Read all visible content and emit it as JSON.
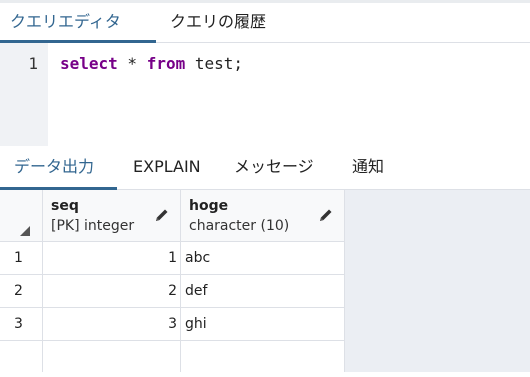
{
  "editor_tabs": [
    {
      "label": "クエリエディタ",
      "active": true
    },
    {
      "label": "クエリの履歴",
      "active": false
    }
  ],
  "editor": {
    "line_number": "1",
    "tokens": [
      "select",
      " * ",
      "from",
      " test;"
    ]
  },
  "output_tabs": [
    {
      "label": "データ出力",
      "active": true
    },
    {
      "label": "EXPLAIN",
      "active": false
    },
    {
      "label": "メッセージ",
      "active": false
    },
    {
      "label": "通知",
      "active": false
    }
  ],
  "grid": {
    "columns": [
      {
        "name": "seq",
        "type": "[PK] integer"
      },
      {
        "name": "hoge",
        "type": "character (10)"
      }
    ],
    "rows": [
      {
        "row_number": "1",
        "seq": "1",
        "hoge": "abc"
      },
      {
        "row_number": "2",
        "seq": "2",
        "hoge": "def"
      },
      {
        "row_number": "3",
        "seq": "3",
        "hoge": "ghi"
      }
    ]
  },
  "colors": {
    "accent": "#326690",
    "keyword": "#770088",
    "gutter": "#f0f2f5",
    "grid_background": "#ebeef3"
  },
  "icons": {
    "column_edit": "pencil-icon",
    "select_all": "select-all-triangle-icon"
  }
}
